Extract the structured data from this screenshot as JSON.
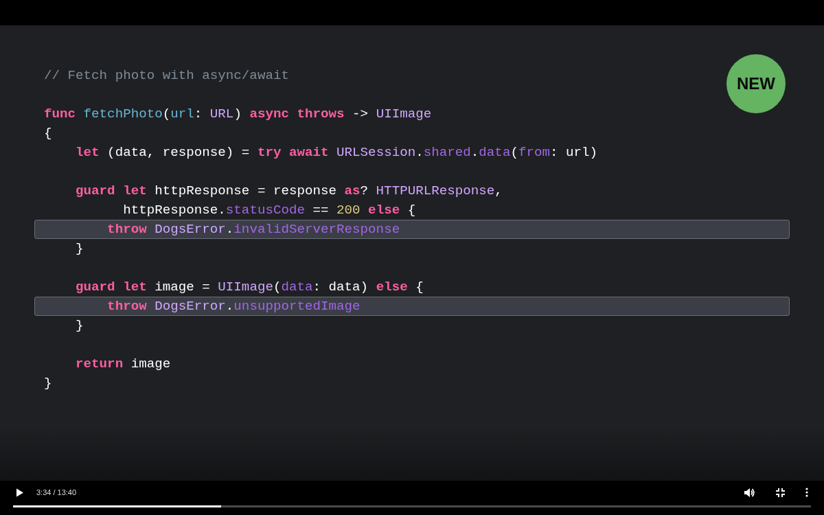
{
  "slide": {
    "badge": "NEW",
    "blocks": [
      {
        "lines": [
          {
            "highlighted": false,
            "tokens": [
              {
                "kind": "comment",
                "text": "// Fetch photo with async/await"
              }
            ]
          }
        ]
      },
      {
        "lines": [
          {
            "highlighted": false,
            "tokens": [
              {
                "kind": "keyword",
                "text": "func "
              },
              {
                "kind": "decl",
                "text": "fetchPhoto"
              },
              {
                "kind": "plain",
                "text": "("
              },
              {
                "kind": "decl",
                "text": "url"
              },
              {
                "kind": "plain",
                "text": ": "
              },
              {
                "kind": "type",
                "text": "URL"
              },
              {
                "kind": "plain",
                "text": ") "
              },
              {
                "kind": "keyword",
                "text": "async throws"
              },
              {
                "kind": "plain",
                "text": " -> "
              },
              {
                "kind": "type",
                "text": "UIImage"
              }
            ]
          },
          {
            "highlighted": false,
            "tokens": [
              {
                "kind": "plain",
                "text": "{"
              }
            ]
          },
          {
            "highlighted": false,
            "tokens": [
              {
                "kind": "keyword",
                "text": "    let"
              },
              {
                "kind": "plain",
                "text": " (data, response) = "
              },
              {
                "kind": "keyword",
                "text": "try await"
              },
              {
                "kind": "type",
                "text": " URLSession"
              },
              {
                "kind": "plain",
                "text": "."
              },
              {
                "kind": "member",
                "text": "shared"
              },
              {
                "kind": "plain",
                "text": "."
              },
              {
                "kind": "member",
                "text": "data"
              },
              {
                "kind": "plain",
                "text": "("
              },
              {
                "kind": "member",
                "text": "from"
              },
              {
                "kind": "plain",
                "text": ": url)"
              }
            ]
          }
        ]
      },
      {
        "lines": [
          {
            "highlighted": false,
            "tokens": [
              {
                "kind": "keyword",
                "text": "    guard let"
              },
              {
                "kind": "plain",
                "text": " httpResponse = response "
              },
              {
                "kind": "keyword",
                "text": "as"
              },
              {
                "kind": "plain",
                "text": "? "
              },
              {
                "kind": "type",
                "text": "HTTPURLResponse"
              },
              {
                "kind": "plain",
                "text": ","
              }
            ]
          },
          {
            "highlighted": false,
            "tokens": [
              {
                "kind": "plain",
                "text": "          httpResponse."
              },
              {
                "kind": "member",
                "text": "statusCode"
              },
              {
                "kind": "plain",
                "text": " == "
              },
              {
                "kind": "number",
                "text": "200"
              },
              {
                "kind": "keyword",
                "text": " else"
              },
              {
                "kind": "plain",
                "text": " {"
              }
            ]
          },
          {
            "highlighted": true,
            "tokens": [
              {
                "kind": "keyword",
                "text": "        throw"
              },
              {
                "kind": "type",
                "text": " DogsError"
              },
              {
                "kind": "plain",
                "text": "."
              },
              {
                "kind": "member",
                "text": "invalidServerResponse"
              }
            ]
          },
          {
            "highlighted": false,
            "tokens": [
              {
                "kind": "plain",
                "text": "    }"
              }
            ]
          }
        ]
      },
      {
        "lines": [
          {
            "highlighted": false,
            "tokens": [
              {
                "kind": "keyword",
                "text": "    guard let"
              },
              {
                "kind": "plain",
                "text": " image = "
              },
              {
                "kind": "type",
                "text": "UIImage"
              },
              {
                "kind": "plain",
                "text": "("
              },
              {
                "kind": "member",
                "text": "data"
              },
              {
                "kind": "plain",
                "text": ": data) "
              },
              {
                "kind": "keyword",
                "text": "else"
              },
              {
                "kind": "plain",
                "text": " {"
              }
            ]
          },
          {
            "highlighted": true,
            "tokens": [
              {
                "kind": "keyword",
                "text": "        throw"
              },
              {
                "kind": "type",
                "text": " DogsError"
              },
              {
                "kind": "plain",
                "text": "."
              },
              {
                "kind": "member",
                "text": "unsupportedImage"
              }
            ]
          },
          {
            "highlighted": false,
            "tokens": [
              {
                "kind": "plain",
                "text": "    }"
              }
            ]
          }
        ]
      },
      {
        "lines": [
          {
            "highlighted": false,
            "tokens": [
              {
                "kind": "keyword",
                "text": "    return"
              },
              {
                "kind": "plain",
                "text": " image"
              }
            ]
          },
          {
            "highlighted": false,
            "tokens": [
              {
                "kind": "plain",
                "text": "}"
              }
            ]
          }
        ]
      }
    ]
  },
  "player": {
    "time": "3:34 / 13:40",
    "progress": {
      "level": 0.261
    }
  }
}
